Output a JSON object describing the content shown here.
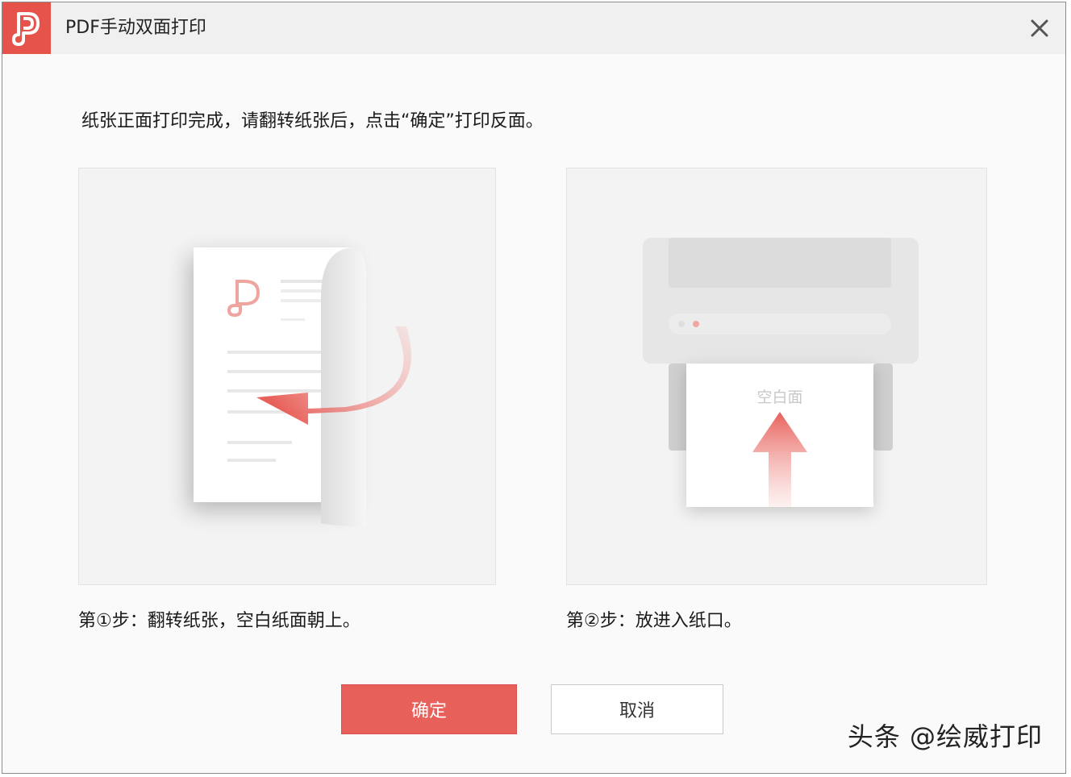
{
  "window": {
    "title": "PDF手动双面打印"
  },
  "main": {
    "instruction": "纸张正面打印完成，请翻转纸张后，点击“确定”打印反面。",
    "step1_label": "第①步：翻转纸张，空白纸面朝上。",
    "step2_label": "第②步：放进入纸口。",
    "paper_blank_side_label": "空白面"
  },
  "buttons": {
    "confirm_label": "确定",
    "cancel_label": "取消"
  },
  "watermark": {
    "text": "头条 @绘威打印"
  },
  "colors": {
    "accent": "#e8605a",
    "brand_logo_bg": "#e5534b"
  },
  "icons": {
    "app_logo": "pdf-logo-icon",
    "close": "close-icon",
    "flip_arrow": "curved-arrow-left-icon",
    "insert_arrow": "arrow-up-icon"
  }
}
